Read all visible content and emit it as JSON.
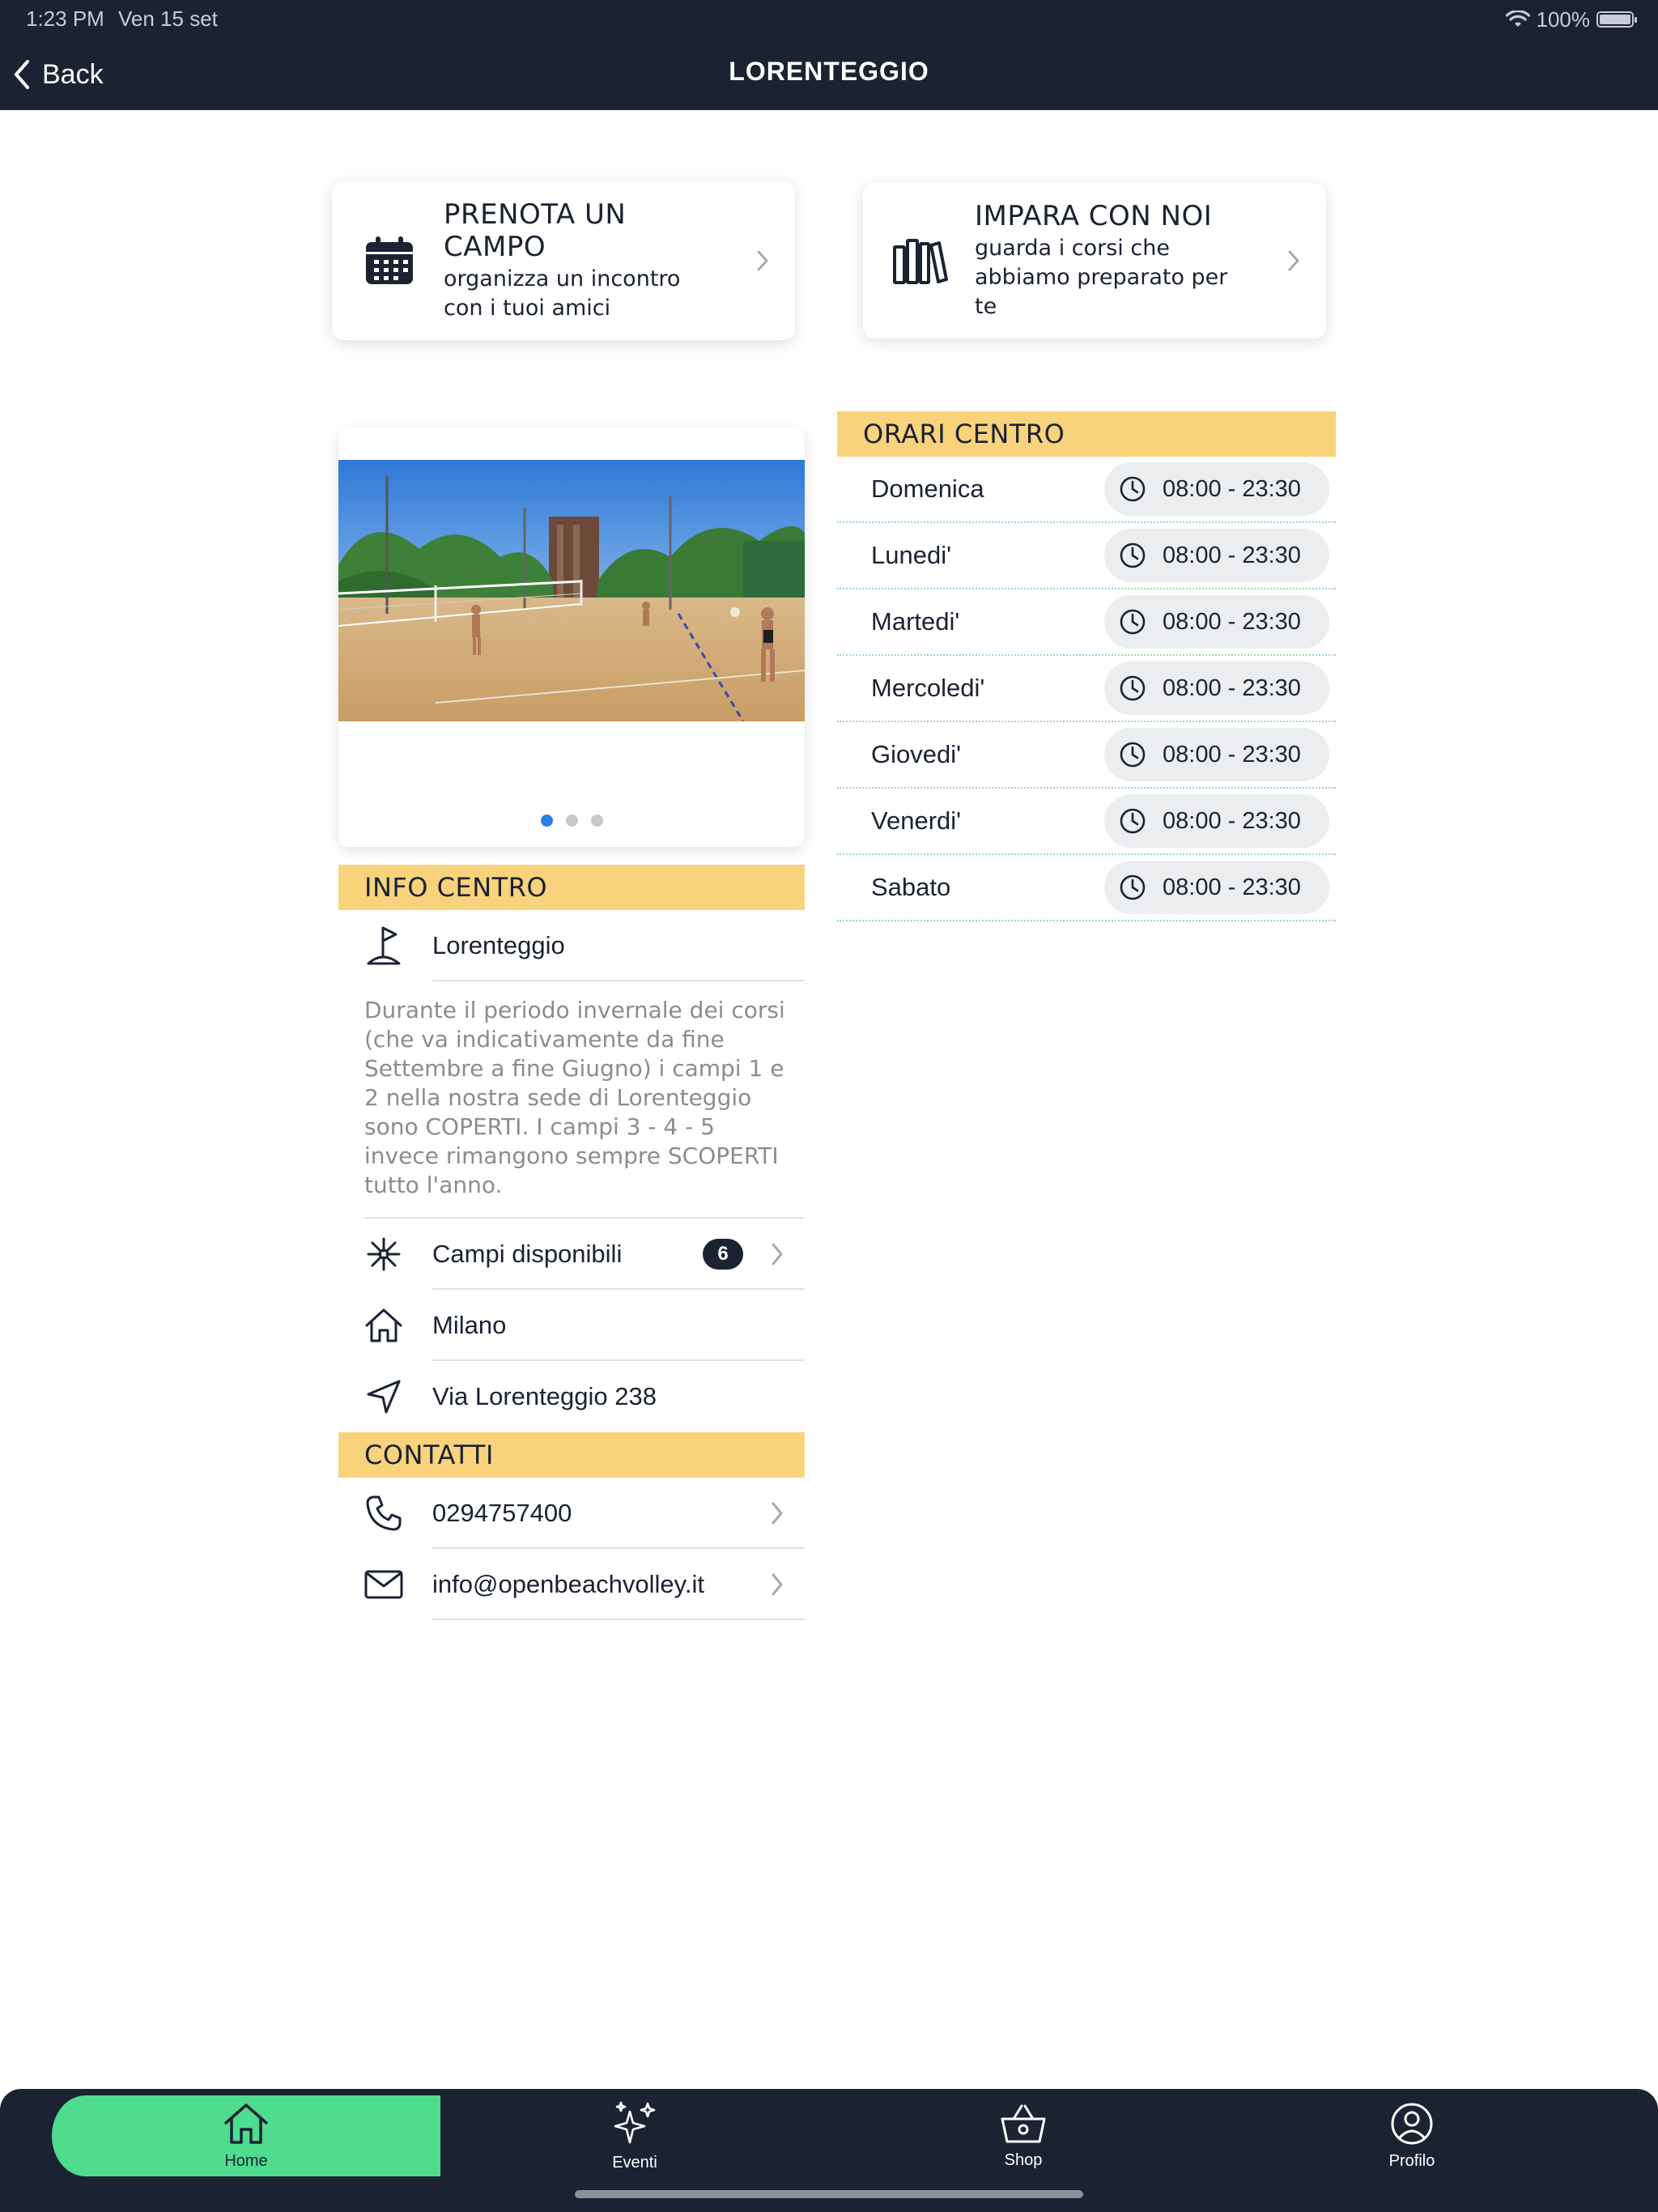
{
  "status_bar": {
    "time": "1:23 PM",
    "date": "Ven 15 set",
    "battery": "100%"
  },
  "nav": {
    "back_label": "Back",
    "title": "LORENTEGGIO"
  },
  "cards": {
    "book": {
      "title": "PRENOTA UN CAMPO",
      "subtitle": "organizza un incontro con i tuoi amici"
    },
    "learn": {
      "title": "IMPARA CON NOI",
      "subtitle": "guarda i corsi che abbiamo preparato per te"
    }
  },
  "slider": {
    "pages": 3,
    "active_index": 0
  },
  "info": {
    "header": "INFO CENTRO",
    "name": "Lorenteggio",
    "description": "Durante il periodo invernale dei corsi (che va indicativamente da fine Settembre a fine Giugno) i campi 1 e 2 nella nostra sede di Lorenteggio sono COPERTI. I campi 3 - 4 - 5 invece rimangono sempre SCOPERTI tutto l'anno.",
    "courts_label": "Campi disponibili",
    "courts_count": "6",
    "city": "Milano",
    "address": "Via Lorenteggio 238"
  },
  "contacts": {
    "header": "CONTATTI",
    "phone": "0294757400",
    "email": "info@openbeachvolley.it"
  },
  "hours": {
    "header": "ORARI CENTRO",
    "days": [
      {
        "day": "Domenica",
        "time": "08:00 - 23:30"
      },
      {
        "day": "Lunedi'",
        "time": "08:00 - 23:30"
      },
      {
        "day": "Martedi'",
        "time": "08:00 - 23:30"
      },
      {
        "day": "Mercoledi'",
        "time": "08:00 - 23:30"
      },
      {
        "day": "Giovedi'",
        "time": "08:00 - 23:30"
      },
      {
        "day": "Venerdi'",
        "time": "08:00 - 23:30"
      },
      {
        "day": "Sabato",
        "time": "08:00 - 23:30"
      }
    ]
  },
  "tabs": [
    {
      "label": "Home",
      "icon": "home-icon",
      "active": true
    },
    {
      "label": "Eventi",
      "icon": "sparkles-icon",
      "active": false
    },
    {
      "label": "Shop",
      "icon": "basket-icon",
      "active": false
    },
    {
      "label": "Profilo",
      "icon": "user-circle-icon",
      "active": false
    }
  ],
  "colors": {
    "navy": "#1b2333",
    "accent_yellow": "#f8d37b",
    "tab_active": "#4fdc8f",
    "dot_active": "#2a7ee5"
  }
}
